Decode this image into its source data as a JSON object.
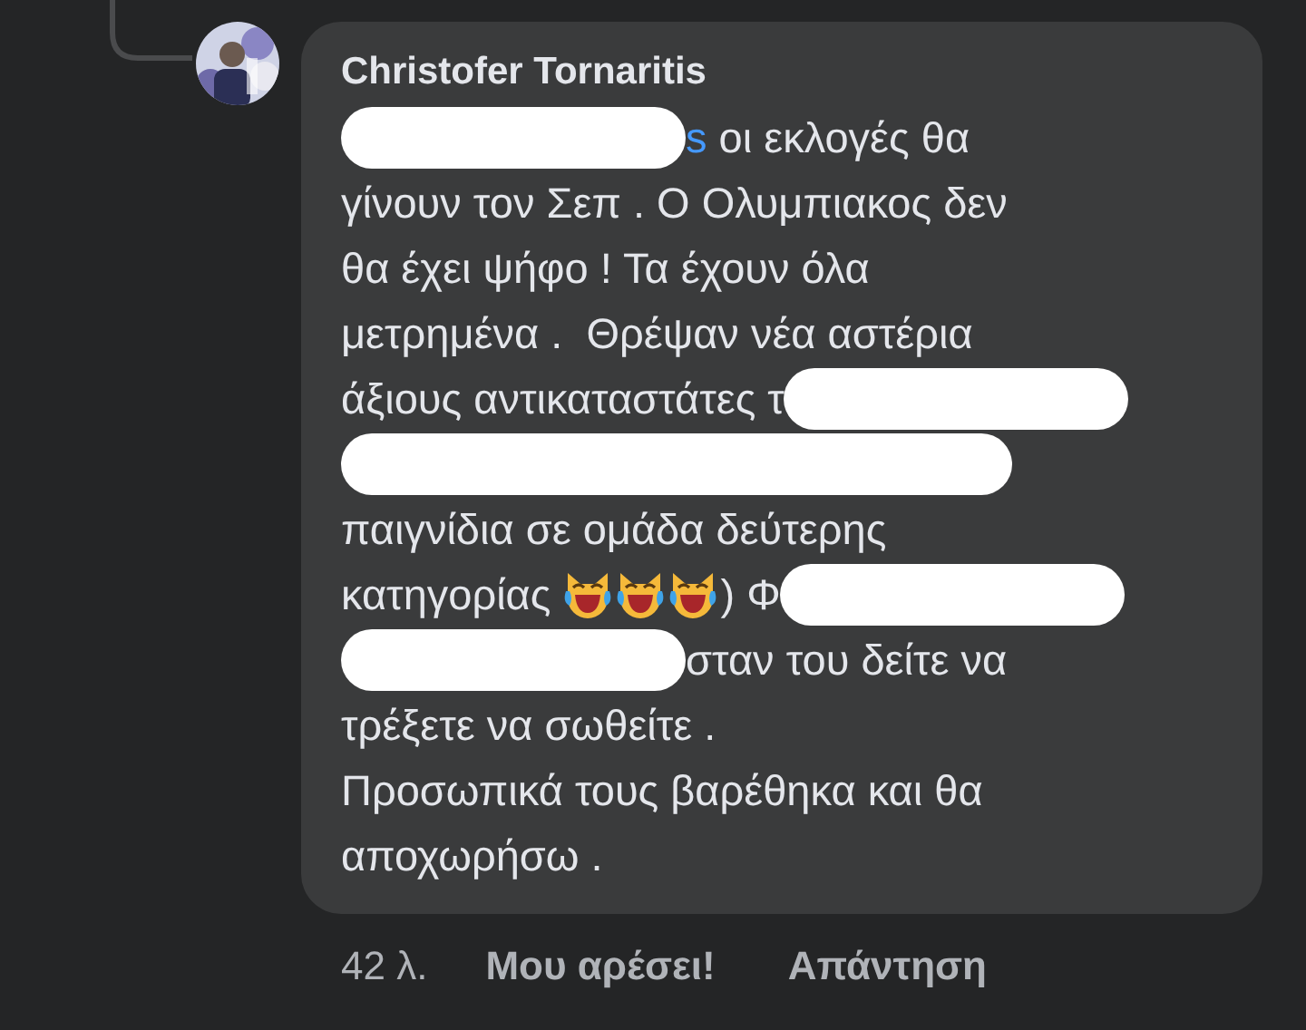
{
  "comment": {
    "author": "Christofer Tornaritis",
    "lines": [
      [
        {
          "kind": "redacted"
        },
        {
          "kind": "mention",
          "text": "s"
        },
        {
          "kind": "text",
          "text": " οι εκλογές θα"
        }
      ],
      [
        {
          "kind": "text",
          "text": "γίνουν τον Σεπ . Ο Ολυμπιακος δεν"
        }
      ],
      [
        {
          "kind": "text",
          "text": "θα έχει ψήφο ! Τα έχουν όλα"
        }
      ],
      [
        {
          "kind": "text",
          "text": "μετρημένα .  Θρέψαν νέα αστέρια"
        }
      ],
      [
        {
          "kind": "text",
          "text": "άξιους αντικαταστάτες τ"
        },
        {
          "kind": "redacted"
        }
      ],
      [
        {
          "kind": "redacted"
        }
      ],
      [
        {
          "kind": "text",
          "text": "παιγνίδια σε ομάδα δεύτερης"
        }
      ],
      [
        {
          "kind": "text",
          "text": "κατηγορίας "
        },
        {
          "kind": "emoji"
        },
        {
          "kind": "emoji"
        },
        {
          "kind": "emoji"
        },
        {
          "kind": "text",
          "text": ") Φ"
        },
        {
          "kind": "redacted"
        }
      ],
      [
        {
          "kind": "redacted"
        },
        {
          "kind": "text",
          "text": "σταν του δείτε να"
        }
      ],
      [
        {
          "kind": "text",
          "text": "τρέξετε να σωθείτε ."
        }
      ],
      [
        {
          "kind": "text",
          "text": "Προσωπικά τους βαρέθηκα και θα"
        }
      ],
      [
        {
          "kind": "text",
          "text": "αποχωρήσω ."
        }
      ]
    ]
  },
  "actions": {
    "time": "42 λ.",
    "like": "Μου αρέσει!",
    "reply": "Απάντηση"
  }
}
